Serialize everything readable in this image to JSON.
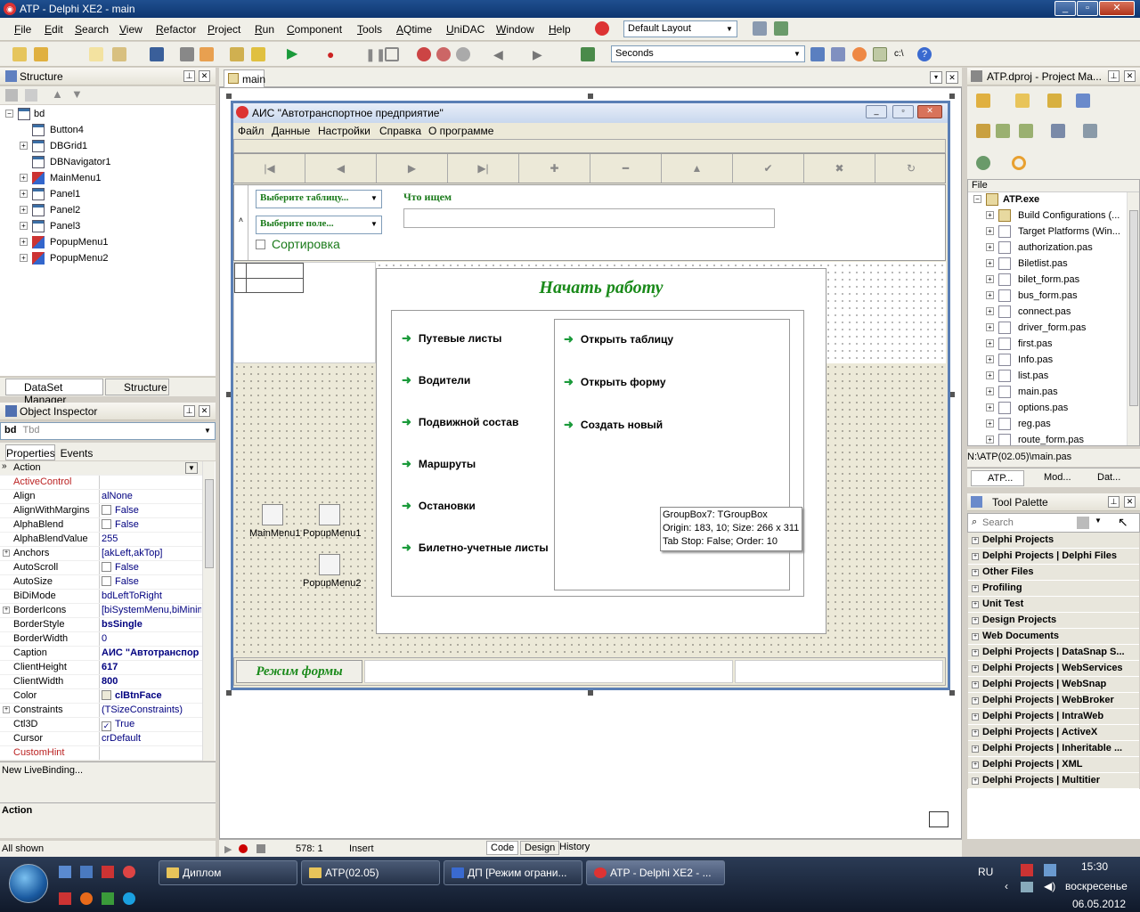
{
  "window": {
    "title": "ATP - Delphi XE2 - main"
  },
  "menu": [
    "File",
    "Edit",
    "Search",
    "View",
    "Refactor",
    "Project",
    "Run",
    "Component",
    "Tools",
    "AQtime",
    "UniDAC",
    "Window",
    "Help"
  ],
  "layout_combo": "Default Layout",
  "toolbar": {
    "seconds_combo": "Seconds"
  },
  "structure": {
    "title": "Structure",
    "root": "bd",
    "items": [
      "Button4",
      "DBGrid1",
      "DBNavigator1",
      "MainMenu1",
      "Panel1",
      "Panel2",
      "Panel3",
      "PopupMenu1",
      "PopupMenu2"
    ]
  },
  "left_tabs": {
    "dataset": "DataSet Manager",
    "structure": "Structure"
  },
  "inspector": {
    "title": "Object Inspector",
    "object": "bd",
    "object_type": "Tbd",
    "tab_properties": "Properties",
    "tab_events": "Events",
    "rows": [
      {
        "name": "Action",
        "value": "",
        "sel": true
      },
      {
        "name": "ActiveControl",
        "value": "",
        "red": true
      },
      {
        "name": "Align",
        "value": "alNone"
      },
      {
        "name": "AlignWithMargins",
        "value": "False",
        "chk": "off"
      },
      {
        "name": "AlphaBlend",
        "value": "False",
        "chk": "off"
      },
      {
        "name": "AlphaBlendValue",
        "value": "255"
      },
      {
        "name": "Anchors",
        "value": "[akLeft,akTop]",
        "plus": true
      },
      {
        "name": "AutoScroll",
        "value": "False",
        "chk": "off"
      },
      {
        "name": "AutoSize",
        "value": "False",
        "chk": "off"
      },
      {
        "name": "BiDiMode",
        "value": "bdLeftToRight"
      },
      {
        "name": "BorderIcons",
        "value": "[biSystemMenu,biMinim",
        "plus": true
      },
      {
        "name": "BorderStyle",
        "value": "bsSingle",
        "bold": true
      },
      {
        "name": "BorderWidth",
        "value": "0"
      },
      {
        "name": "Caption",
        "value": "АИС \"Автотранспор",
        "bold": true
      },
      {
        "name": "ClientHeight",
        "value": "617",
        "bold": true
      },
      {
        "name": "ClientWidth",
        "value": "800",
        "bold": true
      },
      {
        "name": "Color",
        "value": "clBtnFace",
        "bold": true,
        "swatch": true
      },
      {
        "name": "Constraints",
        "value": "(TSizeConstraints)",
        "plus": true
      },
      {
        "name": "Ctl3D",
        "value": "True",
        "chk": "on"
      },
      {
        "name": "Cursor",
        "value": "crDefault"
      },
      {
        "name": "CustomHint",
        "value": "",
        "red": true
      }
    ],
    "livebinding": "New LiveBinding...",
    "desc_title": "Action",
    "status": "All shown"
  },
  "editor": {
    "tab": "main",
    "status_pos": "578:  1",
    "status_mode": "Insert",
    "bottom_tabs": [
      "Code",
      "Design",
      "History"
    ]
  },
  "form": {
    "caption": "АИС \"Автотранспортное предприятие\"",
    "menu": [
      "Файл",
      "Данные",
      "Настройки",
      "Справка",
      "О программе"
    ],
    "combo_table": "Выберите таблицу...",
    "combo_field": "Выберите поле...",
    "search_label": "Что ищем",
    "sort_label": "Сортировка",
    "start_title": "Начать работу",
    "left_links": [
      "Путевые листы",
      "Водители",
      "Подвижной состав",
      "Маршруты",
      "Остановки",
      "Билетно-учетные листы"
    ],
    "right_links": [
      "Открыть таблицу",
      "Открыть форму",
      "Создать новый"
    ],
    "components": [
      "MainMenu1",
      "PopupMenu1",
      "PopupMenu2"
    ],
    "status_panel": "Режим формы",
    "hint": [
      "GroupBox7: TGroupBox",
      "Origin: 183, 10; Size: 266 x 311",
      "Tab Stop: False; Order: 10"
    ]
  },
  "project": {
    "title": "ATP.dproj - Project Ma...",
    "file_header": "File",
    "root": "ATP.exe",
    "items": [
      "Build Configurations (...",
      "Target Platforms (Win...",
      "authorization.pas",
      "Biletlist.pas",
      "bilet_form.pas",
      "bus_form.pas",
      "connect.pas",
      "driver_form.pas",
      "first.pas",
      "Info.pas",
      "list.pas",
      "main.pas",
      "options.pas",
      "reg.pas",
      "route_form.pas"
    ],
    "path": "N:\\ATP(02.05)\\main.pas",
    "tabs": [
      "ATP...",
      "Mod...",
      "Dat..."
    ]
  },
  "palette": {
    "title": "Tool Palette",
    "search_placeholder": "Search",
    "groups": [
      "Delphi Projects",
      "Delphi Projects | Delphi Files",
      "Other Files",
      "Profiling",
      "Unit Test",
      "Design Projects",
      "Web Documents",
      "Delphi Projects | DataSnap S...",
      "Delphi Projects | WebServices",
      "Delphi Projects | WebSnap",
      "Delphi Projects | WebBroker",
      "Delphi Projects | IntraWeb",
      "Delphi Projects | ActiveX",
      "Delphi Projects | Inheritable ...",
      "Delphi Projects | XML",
      "Delphi Projects | Multitier"
    ]
  },
  "taskbar": {
    "tasks": [
      "Диплом",
      "ATP(02.05)",
      "ДП [Режим ограни...",
      "ATP - Delphi XE2 - ..."
    ],
    "lang": "RU",
    "time": "15:30",
    "day": "воскресенье",
    "date": "06.05.2012"
  }
}
